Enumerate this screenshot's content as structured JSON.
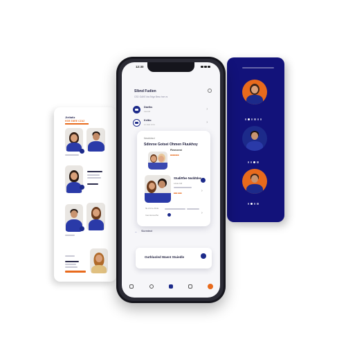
{
  "phone": {
    "status_time": "12:30",
    "header_title": "Slbnd Fudien",
    "header_subline": "CSD  GAKE  kta  Srtgz  Besc hne  vs",
    "list_rows": [
      {
        "title": "Daelks",
        "subtitle": "Lasmd"
      },
      {
        "title": "Keltio",
        "subtitle": "Lo  Aes  Lrnu"
      }
    ],
    "card": {
      "eyebrow": "Nestrkhed",
      "heading": "Sdinroe Gotsei Ohmen Fluukhoy",
      "sub": "Flmmeest",
      "item1_title": "StudiRfee Noddtdes",
      "item1_detail": "Ldste bld",
      "orange_label_1": "■■■■■■■",
      "orange_label_2": "■■■ ■■■",
      "footer_text": "fla  Lhrne  Ahde",
      "item_small": "Ines Esnoefho"
    },
    "lower_row_text": "Slormtect",
    "bottom_card_text": "Outhluoled Waent Stuiedle"
  },
  "left_screen": {
    "title": "Jieliatiz",
    "tag": "HSR  SNRE  CZUZ"
  },
  "colors": {
    "navy": "#1c2a8a",
    "blue_panel": "#12127a",
    "accent_orange": "#e86a1c"
  }
}
